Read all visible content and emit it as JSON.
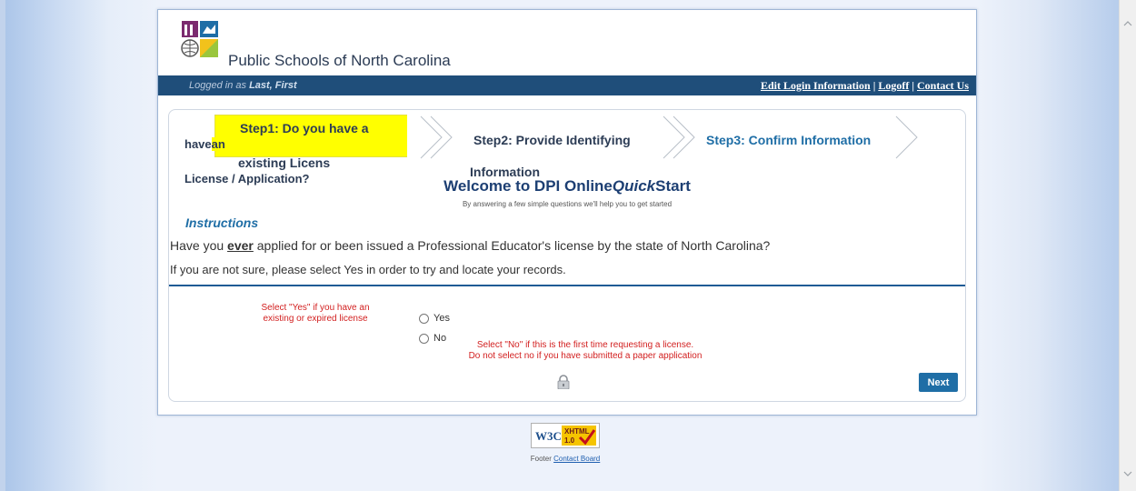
{
  "site": {
    "title": "Public Schools of North Carolina"
  },
  "header": {
    "logged_in_prefix": "Logged in as",
    "user_name": "Last, First",
    "links": [
      "Edit Login Information",
      "Logoff",
      "Contact Us"
    ],
    "separator": "|"
  },
  "steps": {
    "step1_line1": "Step1: Do you have a",
    "step1_line2": "existing Licens",
    "step1_left_line1": "have",
    "step1_left_highlight": "an",
    "step1_left_line2": "License / Application?",
    "step2_line1": "Step2: Provide Identifying",
    "step2_line2": "Information",
    "step3_line1": "Step3: Confirm Information",
    "step1_bg": "#ffff00",
    "step3_color": "#1f6ea6"
  },
  "welcome": {
    "part1": "Welcome to DPI Online",
    "part2": "Quick",
    "part3": "Start",
    "tagline": "By answering a few simple questions we'll help you to get started"
  },
  "instructions": {
    "title": "Instructions",
    "q_before": "Have you",
    "q_ever": "ever",
    "q_after": "applied for or been issued a Professional Educator's license by the state of North Carolina?",
    "note": "If you are not sure, please select Yes in order to try and locate your records."
  },
  "options": {
    "hint_yes_1": "Select \"Yes\" if you have an",
    "hint_yes_2": "existing or expired license",
    "yes_label": "Yes",
    "no_label": "No",
    "hint_no_1": "Select \"No\" if this is the first time requesting a license.",
    "hint_no_2": "Do not select no if you have submitted a paper application",
    "hint_color": "#d21f1f"
  },
  "actions": {
    "next_label": "Next",
    "next_color": "#1f6ea6"
  },
  "footer": {
    "badge_left": "W3C",
    "badge_top": "XHTML",
    "badge_bottom": "1.0",
    "prefix": "Footer",
    "link": "Contact Board"
  },
  "icons": {
    "logo": "ncdpi-logo-icon",
    "lock": "lock-icon",
    "scroll_up": "chevron-up-icon",
    "scroll_down": "chevron-down-icon"
  }
}
